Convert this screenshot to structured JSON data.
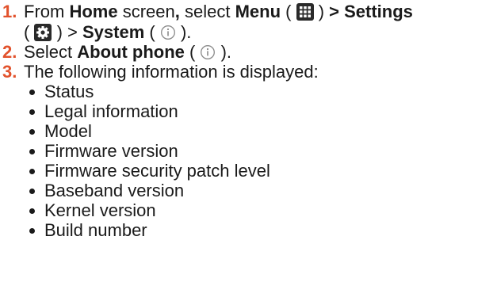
{
  "steps": [
    {
      "number": "1.",
      "line1": {
        "from": "From ",
        "home": "Home",
        "screen": " screen",
        "comma": ",",
        "select": " select ",
        "menu": "Menu",
        "paren_open": " ( ",
        "paren_close": " ) ",
        "gt_settings": "> Settings"
      },
      "line2": {
        "paren_open": "( ",
        "paren_close": " ) ",
        "gt": "> ",
        "system": "System",
        "paren_open2": " ( ",
        "paren_close2": " )."
      }
    },
    {
      "number": "2.",
      "select": "Select ",
      "about": "About phone",
      "paren_open": " ( ",
      "paren_close": " )."
    },
    {
      "number": "3.",
      "text": "The following information is displayed:"
    }
  ],
  "info_items": [
    "Status",
    "Legal information",
    "Model",
    "Firmware version",
    "Firmware security patch level",
    "Baseband version",
    "Kernel version",
    "Build number"
  ],
  "icons": {
    "menu": "grid-menu-icon",
    "settings": "gear-icon",
    "info": "info-icon"
  },
  "colors": {
    "step_number": "#e2522c",
    "text": "#1a1a1a",
    "icon_bg": "#2a2a2a"
  }
}
